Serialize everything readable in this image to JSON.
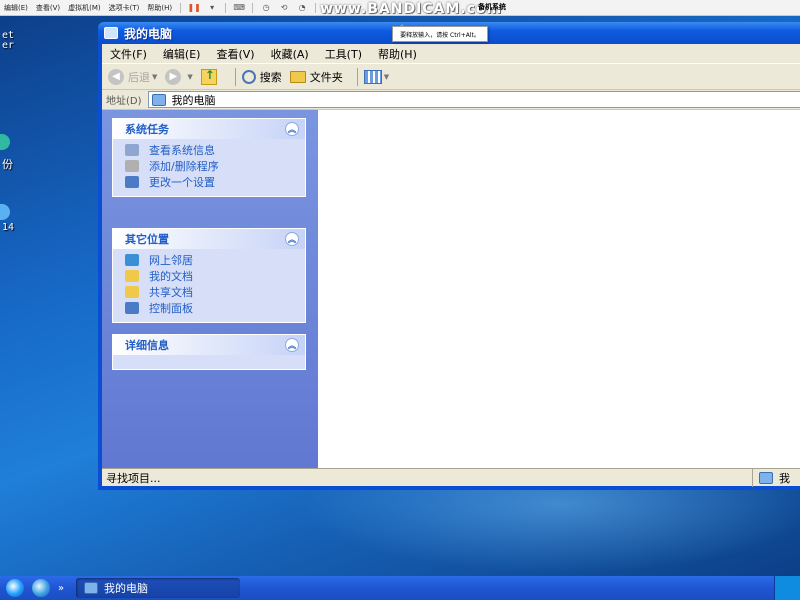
{
  "host_menu": [
    "编辑(E)",
    "查看(V)",
    "虚拟机(M)",
    "选项卡(T)",
    "帮助(H)"
  ],
  "watermark": "www.BANDICAM.com",
  "vm_tab_title": "备机系统",
  "tooltip": "要释放输入，请按 Ctrl+Alt。",
  "desktop_labels": [
    "et",
    "er",
    "份",
    "14"
  ],
  "window": {
    "title": "我的电脑",
    "menu": [
      "文件(F)",
      "编辑(E)",
      "查看(V)",
      "收藏(A)",
      "工具(T)",
      "帮助(H)"
    ],
    "toolbar": {
      "back": "后退",
      "search": "搜索",
      "folders": "文件夹"
    },
    "address_label": "地址(D)",
    "address_value": "我的电脑",
    "groups": [
      {
        "title": "系统任务",
        "items": [
          {
            "label": "查看系统信息",
            "icon": "system-info-icon",
            "color": "#8fa6d0"
          },
          {
            "label": "添加/删除程序",
            "icon": "add-remove-icon",
            "color": "#b0b0b0"
          },
          {
            "label": "更改一个设置",
            "icon": "control-panel-icon",
            "color": "#4a7bc4"
          }
        ]
      },
      {
        "title": "其它位置",
        "items": [
          {
            "label": "网上邻居",
            "icon": "network-icon",
            "color": "#3a8fd6"
          },
          {
            "label": "我的文档",
            "icon": "my-documents-icon",
            "color": "#f1c94a"
          },
          {
            "label": "共享文档",
            "icon": "shared-docs-icon",
            "color": "#f1c94a"
          },
          {
            "label": "控制面板",
            "icon": "control-panel-icon",
            "color": "#4a7bc4"
          }
        ]
      },
      {
        "title": "详细信息",
        "items": []
      }
    ],
    "status_text": "寻找项目...",
    "status_right": "我"
  },
  "taskbar": {
    "button": "我的电脑",
    "chevron": "»"
  }
}
